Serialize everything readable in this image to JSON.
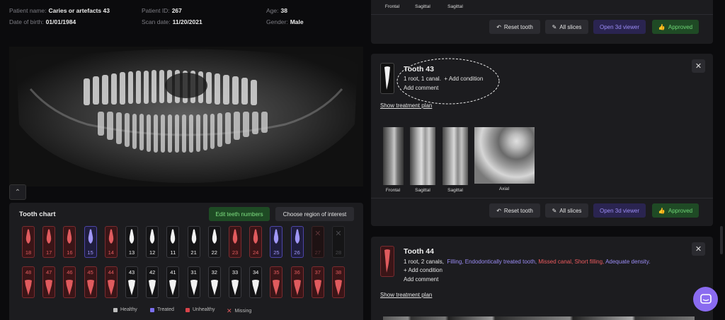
{
  "patient": {
    "name_label": "Patient name:",
    "name": "Caries or artefacts 43",
    "dob_label": "Date of birth:",
    "dob": "01/01/1984",
    "id_label": "Patient ID:",
    "id": "267",
    "scan_label": "Scan date:",
    "scan_date": "11/20/2021",
    "age_label": "Age:",
    "age": "38",
    "gender_label": "Gender:",
    "gender": "Male"
  },
  "tooth_chart": {
    "title": "Tooth chart",
    "edit_button": "Edit teeth numbers",
    "region_button": "Choose region of interest",
    "upper": [
      {
        "num": "18",
        "state": "unhealthy"
      },
      {
        "num": "17",
        "state": "unhealthy"
      },
      {
        "num": "16",
        "state": "unhealthy"
      },
      {
        "num": "15",
        "state": "treated"
      },
      {
        "num": "14",
        "state": "unhealthy"
      },
      {
        "num": "13",
        "state": "healthy"
      },
      {
        "num": "12",
        "state": "healthy"
      },
      {
        "num": "11",
        "state": "healthy"
      },
      {
        "num": "21",
        "state": "healthy"
      },
      {
        "num": "22",
        "state": "healthy"
      },
      {
        "num": "23",
        "state": "unhealthy"
      },
      {
        "num": "24",
        "state": "unhealthy"
      },
      {
        "num": "25",
        "state": "treated"
      },
      {
        "num": "26",
        "state": "treated"
      },
      {
        "num": "27",
        "state": "missing"
      },
      {
        "num": "28",
        "state": "missing-grey"
      }
    ],
    "lower": [
      {
        "num": "48",
        "state": "unhealthy"
      },
      {
        "num": "47",
        "state": "unhealthy"
      },
      {
        "num": "46",
        "state": "unhealthy"
      },
      {
        "num": "45",
        "state": "unhealthy"
      },
      {
        "num": "44",
        "state": "unhealthy"
      },
      {
        "num": "43",
        "state": "healthy"
      },
      {
        "num": "42",
        "state": "healthy"
      },
      {
        "num": "41",
        "state": "healthy"
      },
      {
        "num": "31",
        "state": "healthy"
      },
      {
        "num": "32",
        "state": "healthy"
      },
      {
        "num": "33",
        "state": "healthy"
      },
      {
        "num": "34",
        "state": "healthy"
      },
      {
        "num": "35",
        "state": "unhealthy"
      },
      {
        "num": "36",
        "state": "unhealthy"
      },
      {
        "num": "37",
        "state": "unhealthy"
      },
      {
        "num": "38",
        "state": "unhealthy"
      }
    ],
    "legend": {
      "healthy": "Healthy",
      "treated": "Treated",
      "unhealthy": "Unhealthy",
      "missing": "Missing"
    }
  },
  "top_card": {
    "labels": [
      "Frontal",
      "Sagittal",
      "Sagittal"
    ],
    "reset": "Reset tooth",
    "all_slices": "All slices",
    "open_3d": "Open 3d viewer",
    "approved": "Approved"
  },
  "tooth43": {
    "title": "Tooth 43",
    "summary": "1 root,  1 canal.",
    "add_condition": "+ Add condition",
    "add_comment": "Add comment",
    "treatment_link": "Show treatment plan",
    "slices": [
      "Frontal",
      "Sagittal",
      "Sagittal",
      "Axial"
    ],
    "reset": "Reset tooth",
    "all_slices": "All slices",
    "open_3d": "Open 3d viewer",
    "approved": "Approved"
  },
  "tooth44": {
    "title": "Tooth 44",
    "summary": "1 root,  2 canals,",
    "conditions": [
      {
        "text": "Filling,",
        "color": "#9b8cf5"
      },
      {
        "text": "Endodontically treated tooth,",
        "color": "#9b8cf5"
      },
      {
        "text": "Missed canal,",
        "color": "#ef5b5f"
      },
      {
        "text": "Short filling,",
        "color": "#ef5b5f"
      },
      {
        "text": "Adequate density.",
        "color": "#9b8cf5"
      }
    ],
    "add_condition": "+ Add condition",
    "add_comment": "Add comment",
    "treatment_link": "Show treatment plan"
  },
  "colors": {
    "healthy": "#bdbdbd",
    "treated": "#7b6ff0",
    "unhealthy": "#d9434a",
    "missing": "#e05b5e",
    "accent": "#8a6bf0"
  }
}
